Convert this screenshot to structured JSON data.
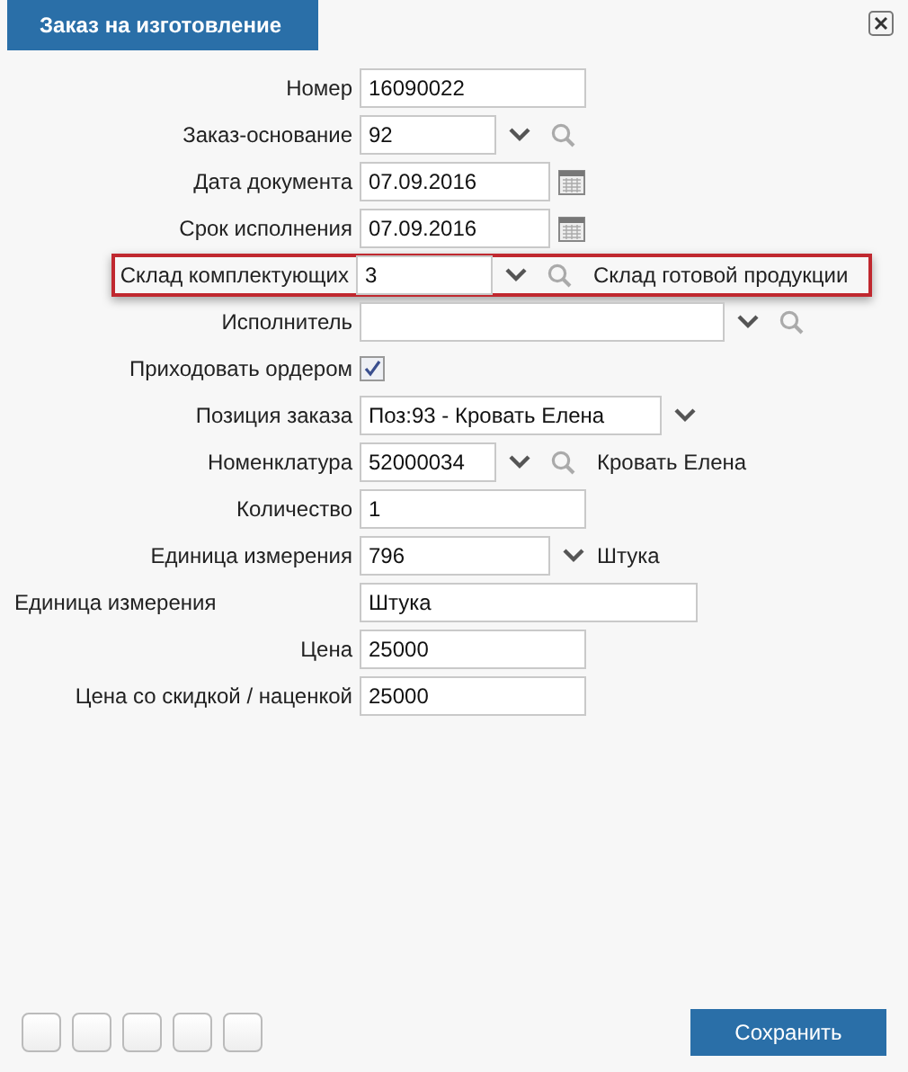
{
  "window": {
    "title": "Заказ на изготовление"
  },
  "rows": [
    {
      "kind": "text",
      "label": "Номер",
      "value": "16090022",
      "highlighted": false
    },
    {
      "kind": "lookup",
      "label": "Заказ-основание",
      "value": "92",
      "highlighted": false
    },
    {
      "kind": "date",
      "label": "Дата документа",
      "value": "07.09.2016",
      "highlighted": false
    },
    {
      "kind": "date",
      "label": "Срок исполнения",
      "value": "07.09.2016",
      "highlighted": false
    },
    {
      "kind": "lookup",
      "label": "Склад комплектующих",
      "value": "3",
      "note": "Склад готовой продукции",
      "highlighted": true
    },
    {
      "kind": "lookup",
      "label": "Исполнитель",
      "value": "",
      "highlighted": false
    },
    {
      "kind": "check",
      "label": "Приходовать ордером",
      "checked": true,
      "highlighted": false
    },
    {
      "kind": "select",
      "label": "Позиция заказа",
      "value": "Поз:93 - Кровать Елена",
      "highlighted": false
    },
    {
      "kind": "lookup",
      "label": "Номенклатура",
      "value": "52000034",
      "note": "Кровать Елена",
      "highlighted": false
    },
    {
      "kind": "text",
      "label": "Количество",
      "value": "1",
      "highlighted": false
    },
    {
      "kind": "select",
      "label": "Единица измерения",
      "value": "796",
      "note": "Штука",
      "highlighted": false
    },
    {
      "kind": "wide",
      "label": "Единица измерения",
      "value": "Штука",
      "highlighted": false
    },
    {
      "kind": "text",
      "label": "Цена",
      "value": "25000",
      "highlighted": false
    },
    {
      "kind": "text",
      "label": "Цена со скидкой / наценкой",
      "value": "25000",
      "highlighted": false
    }
  ],
  "footer": {
    "slots": [
      {
        "kind": "blank"
      },
      {
        "kind": "blank"
      },
      {
        "kind": "blank"
      },
      {
        "kind": "blank"
      },
      {
        "kind": "blank"
      }
    ],
    "save": "Сохранить"
  }
}
